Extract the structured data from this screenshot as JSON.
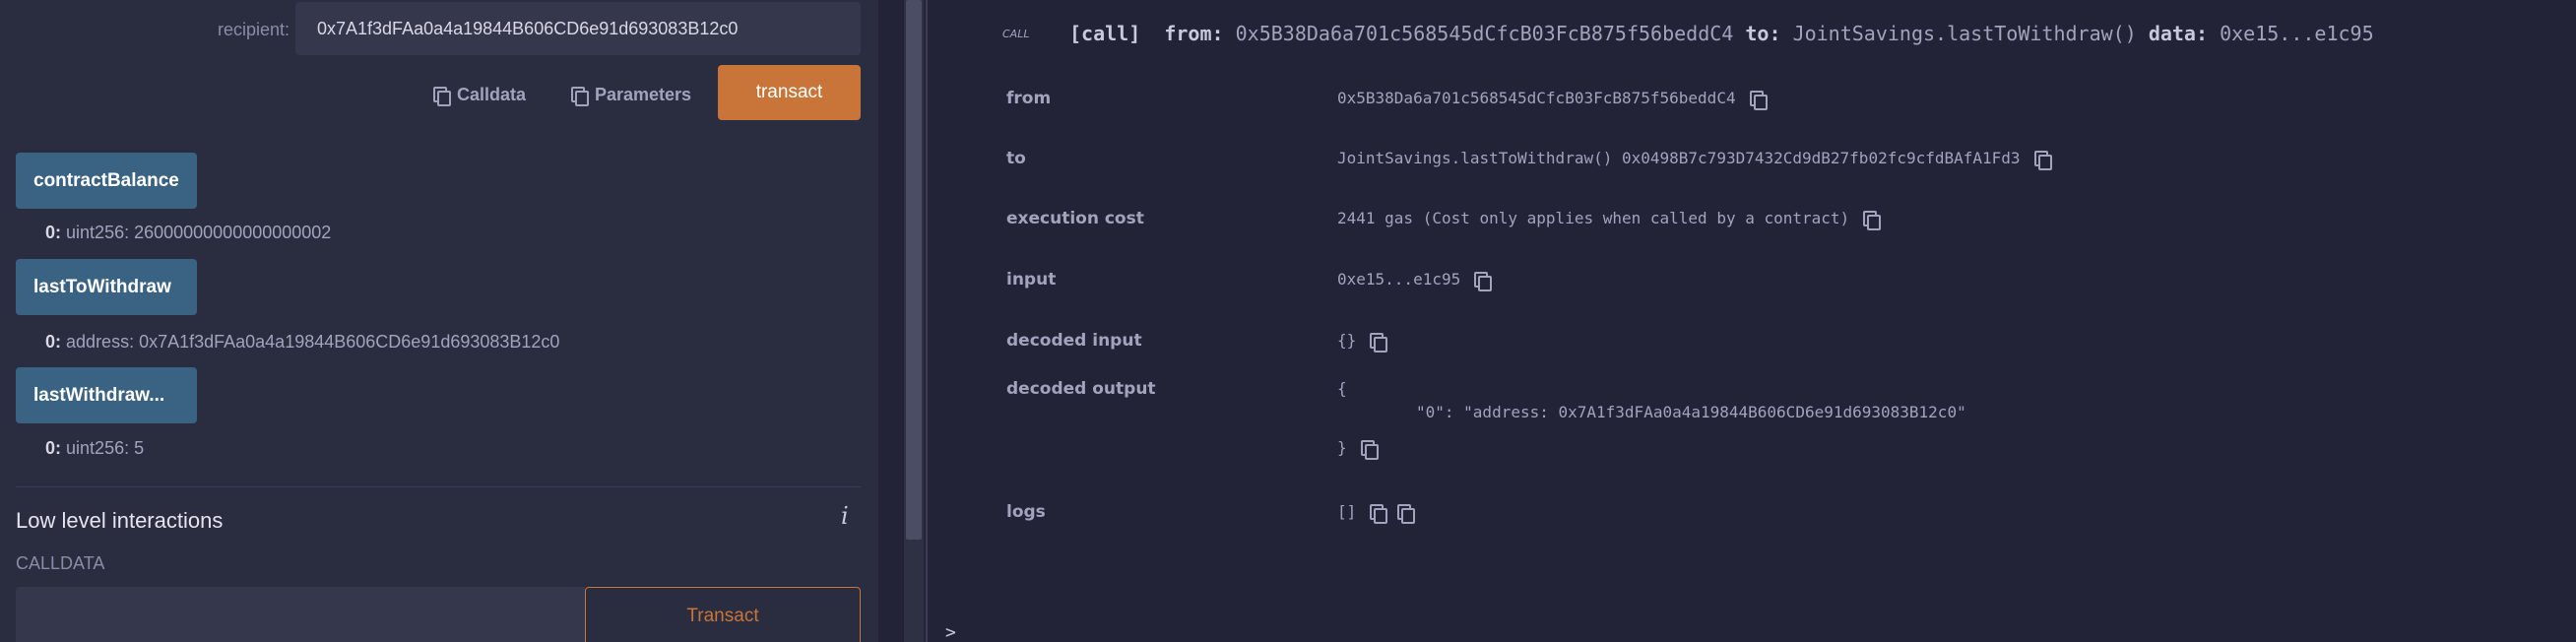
{
  "left": {
    "recipient_label": "recipient:",
    "recipient_value": "0x7A1f3dFAa0a4a19844B606CD6e91d693083B12c0",
    "calldata_button": "Calldata",
    "parameters_button": "Parameters",
    "transact_button": "transact",
    "functions": [
      {
        "label": "contractBalance",
        "output_index": "0:",
        "output_value": "uint256: 26000000000000000002"
      },
      {
        "label": "lastToWithdraw",
        "output_index": "0:",
        "output_value": "address: 0x7A1f3dFAa0a4a19844B606CD6e91d693083B12c0"
      },
      {
        "label": "lastWithdraw...",
        "output_index": "0:",
        "output_value": "uint256: 5"
      }
    ],
    "low_level_title": "Low level interactions",
    "info_icon": "i",
    "calldata_label": "CALLDATA",
    "transact_outline_button": "Transact"
  },
  "terminal": {
    "call_tag": "CALL",
    "summary_call": "[call]",
    "summary_from_label": "from:",
    "summary_from": "0x5B38Da6a701c568545dCfcB03FcB875f56beddC4",
    "summary_to_label": "to:",
    "summary_to": "JointSavings.lastToWithdraw()",
    "summary_data_label": "data:",
    "summary_data": "0xe15...e1c95",
    "rows": {
      "from": {
        "key": "from",
        "value": "0x5B38Da6a701c568545dCfcB03FcB875f56beddC4"
      },
      "to": {
        "key": "to",
        "value": "JointSavings.lastToWithdraw() 0x0498B7c793D7432Cd9dB27fb02fc9cfdBAfA1Fd3"
      },
      "execution_cost": {
        "key": "execution cost",
        "value": "2441 gas (Cost only applies when called by a contract)"
      },
      "input": {
        "key": "input",
        "value": "0xe15...e1c95"
      },
      "decoded_input": {
        "key": "decoded input",
        "value": "{}"
      },
      "decoded_output": {
        "key": "decoded output",
        "open": "{",
        "line": "\"0\": \"address: 0x7A1f3dFAa0a4a19844B606CD6e91d693083B12c0\"",
        "close": "}"
      },
      "logs": {
        "key": "logs",
        "value": "[]"
      }
    },
    "prompt": ">"
  },
  "icons": [
    "copy-icon",
    "info-icon",
    "chevron-right-icon"
  ],
  "colors": {
    "transact": "#c97539",
    "function_button": "#3a6383",
    "panel_bg": "#2a2c3f",
    "terminal_bg": "#222336"
  }
}
